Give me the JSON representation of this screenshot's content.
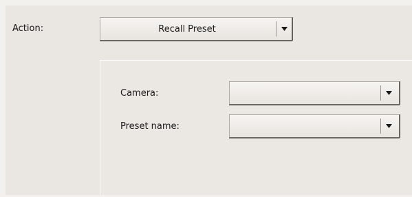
{
  "action": {
    "label": "Action:",
    "selected": "Recall Preset",
    "icon": "chevron-down-icon"
  },
  "camera": {
    "label": "Camera:",
    "selected": ""
  },
  "preset": {
    "label": "Preset name:",
    "selected": ""
  },
  "colors": {
    "background": "#eae7e3",
    "text": "#1a1a1a"
  }
}
